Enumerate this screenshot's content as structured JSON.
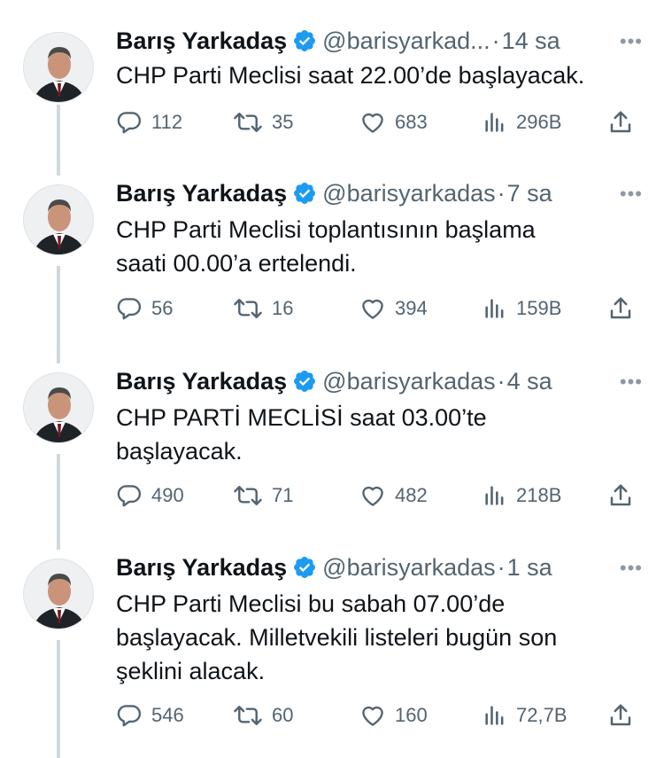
{
  "tweets": [
    {
      "name": "Barış Yarkadaş",
      "handle": "@barisyarkad...",
      "time": "14 sa",
      "text": "CHP Parti Meclisi saat 22.00’de başlayacak.",
      "replies": "112",
      "retweets": "35",
      "likes": "683",
      "views": "296B"
    },
    {
      "name": "Barış Yarkadaş",
      "handle": "@barisyarkadas",
      "time": "7 sa",
      "text": "CHP Parti Meclisi toplantısının başlama\nsaati 00.00’a ertelendi.",
      "replies": "56",
      "retweets": "16",
      "likes": "394",
      "views": "159B"
    },
    {
      "name": "Barış Yarkadaş",
      "handle": "@barisyarkadas",
      "time": "4 sa",
      "text": "CHP PARTİ MECLİSİ saat 03.00’te\nbaşlayacak.",
      "replies": "490",
      "retweets": "71",
      "likes": "482",
      "views": "218B"
    },
    {
      "name": "Barış Yarkadaş",
      "handle": "@barisyarkadas",
      "time": "1 sa",
      "text": "CHP Parti Meclisi bu sabah 07.00’de\nbaşlayacak. Milletvekili listeleri bugün son\nşeklini alacak.",
      "replies": "546",
      "retweets": "60",
      "likes": "160",
      "views": "72,7B"
    }
  ],
  "separator": "·",
  "more_glyph": "•••",
  "icons": {
    "verified": "verified-badge-icon",
    "reply": "reply-icon",
    "retweet": "retweet-icon",
    "like": "heart-icon",
    "views": "views-icon",
    "share": "share-icon"
  },
  "colors": {
    "text": "#0f1419",
    "secondary": "#536471",
    "verified": "#1d9bf0",
    "thread_line": "#cfd9de"
  }
}
